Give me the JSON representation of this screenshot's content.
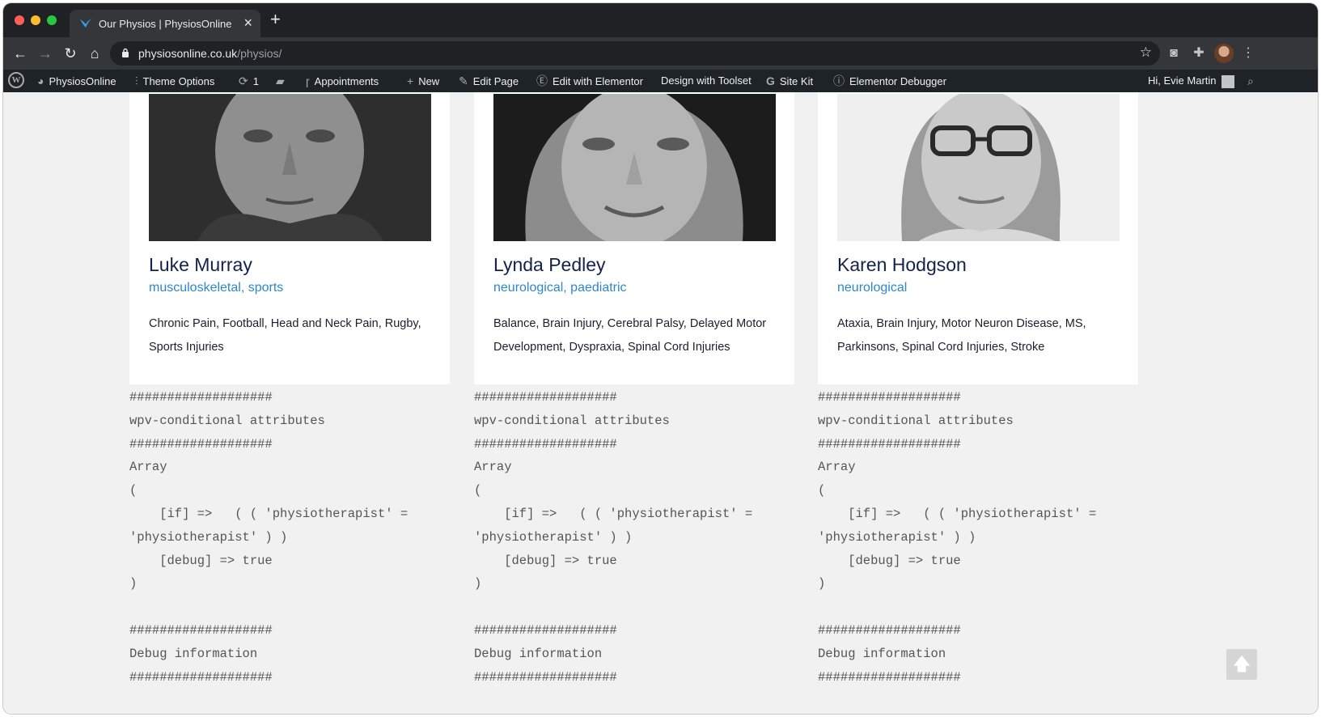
{
  "browser": {
    "tab_title": "Our Physios | PhysiosOnline",
    "tab_close": "×",
    "new_tab": "+",
    "url_host": "physiosonline.co.uk",
    "url_path": "/physios/"
  },
  "admin_bar": {
    "site_name": "PhysiosOnline",
    "theme_options": "Theme Options",
    "updates_count": "1",
    "appointments": "Appointments",
    "new": "New",
    "edit_page": "Edit Page",
    "edit_elementor": "Edit with Elementor",
    "design_toolset": "Design with Toolset",
    "site_kit": "Site Kit",
    "elementor_debugger": "Elementor Debugger",
    "greeting": "Hi, Evie Martin"
  },
  "physios": [
    {
      "name": "Luke Murray",
      "specialty": "musculoskeletal, sports",
      "conditions": "Chronic Pain, Football, Head and Neck Pain, Rugby, Sports Injuries"
    },
    {
      "name": "Lynda Pedley",
      "specialty": "neurological, paediatric",
      "conditions": "Balance, Brain Injury, Cerebral Palsy, Delayed Motor Development, Dyspraxia, Spinal Cord Injuries"
    },
    {
      "name": "Karen Hodgson",
      "specialty": "neurological",
      "conditions": "Ataxia, Brain Injury, Motor Neuron Disease, MS, Parkinsons, Spinal Cord Injuries, Stroke"
    }
  ],
  "debug_text": "###################\nwpv-conditional attributes\n###################\nArray\n(\n    [if] =>   ( ( 'physiotherapist' =\n'physiotherapist' ) )\n    [debug] => true\n)\n\n###################\nDebug information\n###################",
  "scroll_top_icon": "arrow-up-icon"
}
